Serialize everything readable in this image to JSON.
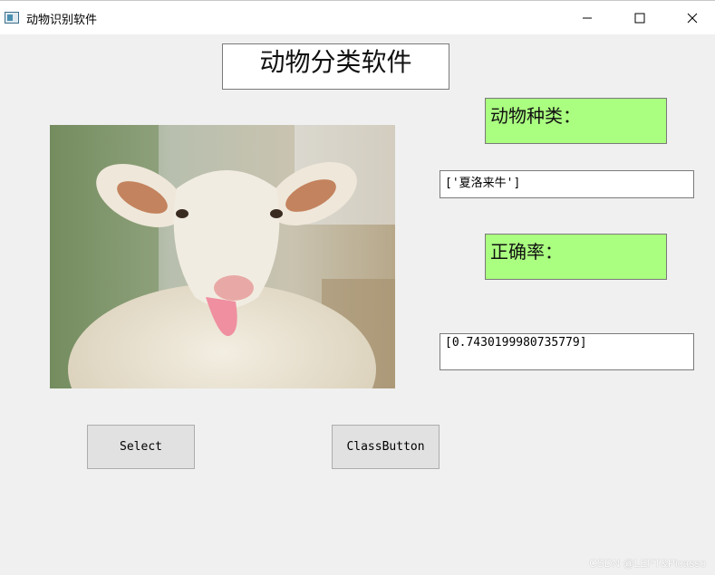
{
  "window": {
    "title": "动物识别软件",
    "icon": "app-window-icon",
    "controls": [
      "minimize-icon",
      "maximize-icon",
      "close-icon"
    ]
  },
  "main": {
    "heading": "动物分类软件",
    "species_label": "动物种类：",
    "species_result": "['夏洛来牛']",
    "accuracy_label": "正确率：",
    "accuracy_result": "[0.7430199980735779]",
    "image": "sheep-photo"
  },
  "buttons": {
    "select": "Select",
    "classify": "ClassButton"
  },
  "watermark": "CSDN @LEFT&Picasso",
  "colors": {
    "label_background": "#aaff80",
    "window_background": "#f0f0f0",
    "button_background": "#e1e1e1"
  }
}
